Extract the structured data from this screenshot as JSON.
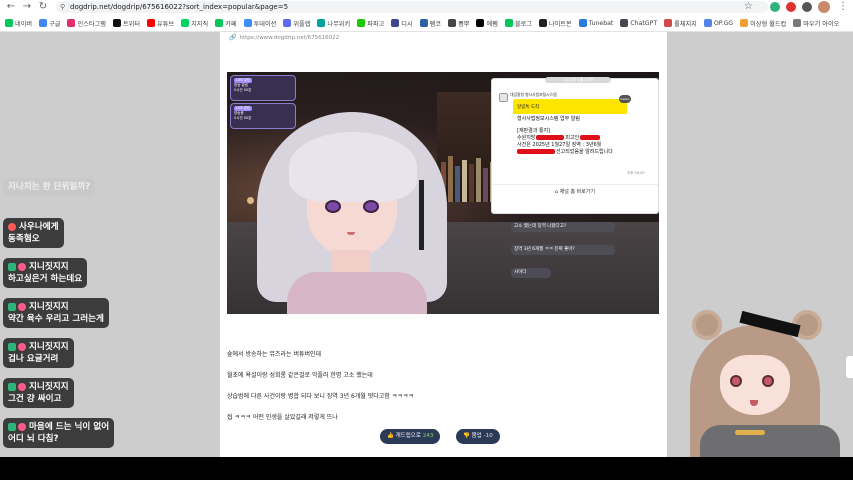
{
  "browser": {
    "url": "dogdrip.net/dogdrip/675616022?sort_index=popular&page=5",
    "bookmarks": [
      {
        "label": "네이버",
        "color": "#03c75a"
      },
      {
        "label": "구글",
        "color": "#4285f4"
      },
      {
        "label": "인스타그램",
        "color": "#e1306c"
      },
      {
        "label": "트위터",
        "color": "#111111"
      },
      {
        "label": "유튜브",
        "color": "#ff0000"
      },
      {
        "label": "치지직",
        "color": "#00d564"
      },
      {
        "label": "카페",
        "color": "#03c75a"
      },
      {
        "label": "투데이션",
        "color": "#3f8cff"
      },
      {
        "label": "위플랩",
        "color": "#5a6df0"
      },
      {
        "label": "나무위키",
        "color": "#00a495"
      },
      {
        "label": "파파고",
        "color": "#1ec800"
      },
      {
        "label": "디시",
        "color": "#3b4890"
      },
      {
        "label": "펨코",
        "color": "#2d5fa7"
      },
      {
        "label": "뽐뿌",
        "color": "#444444"
      },
      {
        "label": "에펨",
        "color": "#000000"
      },
      {
        "label": "블로그",
        "color": "#03c75a"
      },
      {
        "label": "나이트몬",
        "color": "#222222"
      },
      {
        "label": "Tunebat",
        "color": "#2b7bdf"
      },
      {
        "label": "ChatGPT",
        "color": "#444654"
      },
      {
        "label": "롤체지지",
        "color": "#d04848"
      },
      {
        "label": "OP.GG",
        "color": "#5383e8"
      },
      {
        "label": "이상형 월드컵",
        "color": "#f0a030"
      },
      {
        "label": "마우기 아이오",
        "color": "#7a7a7a"
      }
    ]
  },
  "article": {
    "source_link": "https://www.dogdrip.net/675616022",
    "paragraphs": [
      "숲에서 방송하는 뮤즈라는 버튜버인데",
      "월초에 욕설이랑 성희롱 같은걸로 악플러 한명 고소 했는데",
      "상습범에 다른 사건이랑 병합 되다 보니 징역 3년 6개월 떳다고함 ㅋㅋㅋㅋ",
      "씹 ㅋㅋㅋ 어떤 인생을 살았길래 저렇게 뜨나"
    ],
    "upvote": {
      "label": "개드립으로",
      "count": "243"
    },
    "downvote": {
      "label": "붐업",
      "count": "-10"
    }
  },
  "video": {
    "panels": [
      {
        "tag": "LIVE 알림",
        "line1": "방송 알림",
        "line2": "0시간 00분"
      },
      {
        "tag": "LIVE 알림",
        "line1": "방송중",
        "line2": "0시간 00분"
      }
    ],
    "kakao": {
      "date": "2025년 1월 27일",
      "sender": "대검찰청 형사사법포털시스템",
      "yellow_title": "알림톡 도착",
      "badge": "kakao",
      "heading": "형사사법정보시스템 업무 알림",
      "line1": "[재판결과 통지]",
      "line2": "수원지방",
      "line3": "피고인",
      "line4": "사건은 2025년 1월27일 징역 : 3년6월",
      "line5": "선고되었음을 알려드립니다",
      "time": "오후 00:00",
      "footer": "채널 홈 바로가기"
    },
    "mini_chats": [
      "고소 했는데 징역 나왔다고?",
      "징역 3년 6개월 ㅋㅋ 진짜 좋아?",
      "사이다"
    ]
  },
  "chat": [
    {
      "user": "",
      "msg": "지나치는 한 단위일까?",
      "faded": true
    },
    {
      "user": "사우나에게",
      "msg": "동족혐오",
      "faded": false
    },
    {
      "user": "지니짓지지",
      "msg": "하고싶은거 하는데요",
      "faded": false
    },
    {
      "user": "지니짓지지",
      "msg": "약간 육수 우리고 그러는게",
      "faded": false
    },
    {
      "user": "지니짓지지",
      "msg": "겁나 요글거려",
      "faded": false
    },
    {
      "user": "지니짓지지",
      "msg": "그건 걍 싸이고",
      "faded": false
    },
    {
      "user": "마음에 드는 닉이 없어",
      "msg": "어디 뇌 다침?",
      "faded": false
    }
  ]
}
